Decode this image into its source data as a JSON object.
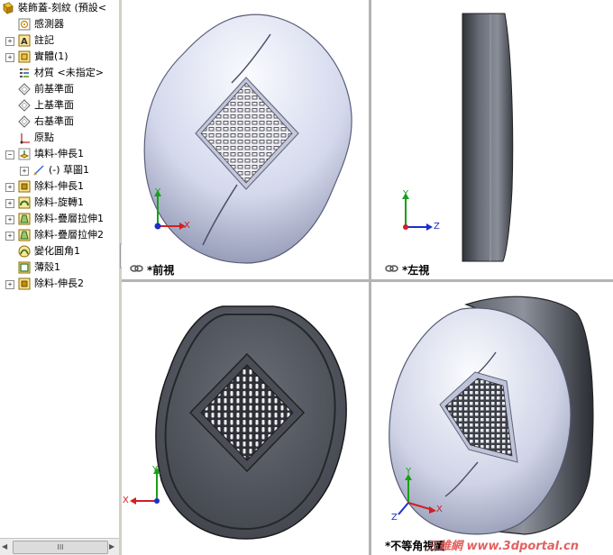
{
  "feature_tree": {
    "root": "裝飾蓋-刻紋 (預設<",
    "items": [
      {
        "label": "感測器",
        "icon": "sensor-icon",
        "expandable": false
      },
      {
        "label": "註記",
        "icon": "annotation-icon",
        "expandable": true
      },
      {
        "label": "實體(1)",
        "icon": "solid-bodies-icon",
        "expandable": true
      },
      {
        "label": "材質 <未指定>",
        "icon": "material-icon",
        "expandable": false
      },
      {
        "label": "前基準面",
        "icon": "plane-icon",
        "expandable": false
      },
      {
        "label": "上基準面",
        "icon": "plane-icon",
        "expandable": false
      },
      {
        "label": "右基準面",
        "icon": "plane-icon",
        "expandable": false
      },
      {
        "label": "原點",
        "icon": "origin-icon",
        "expandable": false
      },
      {
        "label": "填料-伸長1",
        "icon": "boss-extrude-icon",
        "expandable": true,
        "expanded": true
      },
      {
        "label": "(-) 草圖1",
        "icon": "sketch-icon",
        "expandable": true,
        "child": true
      },
      {
        "label": "除料-伸長1",
        "icon": "cut-extrude-icon",
        "expandable": true
      },
      {
        "label": "除料-旋轉1",
        "icon": "cut-revolve-icon",
        "expandable": true
      },
      {
        "label": "除料-疊層拉伸1",
        "icon": "cut-loft-icon",
        "expandable": true
      },
      {
        "label": "除料-疊層拉伸2",
        "icon": "cut-loft-icon",
        "expandable": true
      },
      {
        "label": "變化圓角1",
        "icon": "variable-fillet-icon",
        "expandable": false
      },
      {
        "label": "薄殼1",
        "icon": "shell-icon",
        "expandable": false
      },
      {
        "label": "除料-伸長2",
        "icon": "cut-extrude-icon",
        "expandable": true
      }
    ],
    "scrollbar_grip": "III"
  },
  "viewports": {
    "front": {
      "label": "*前視"
    },
    "left": {
      "label": "*左視"
    },
    "trimetric": {
      "label": "*不等角視圖"
    }
  },
  "axes": {
    "x": "X",
    "y": "Y",
    "z": "Z"
  },
  "watermark": "三維網 www.3dportal.cn",
  "colors": {
    "x_axis": "#d02020",
    "y_axis": "#18a018",
    "z_axis": "#1c2fc8"
  }
}
